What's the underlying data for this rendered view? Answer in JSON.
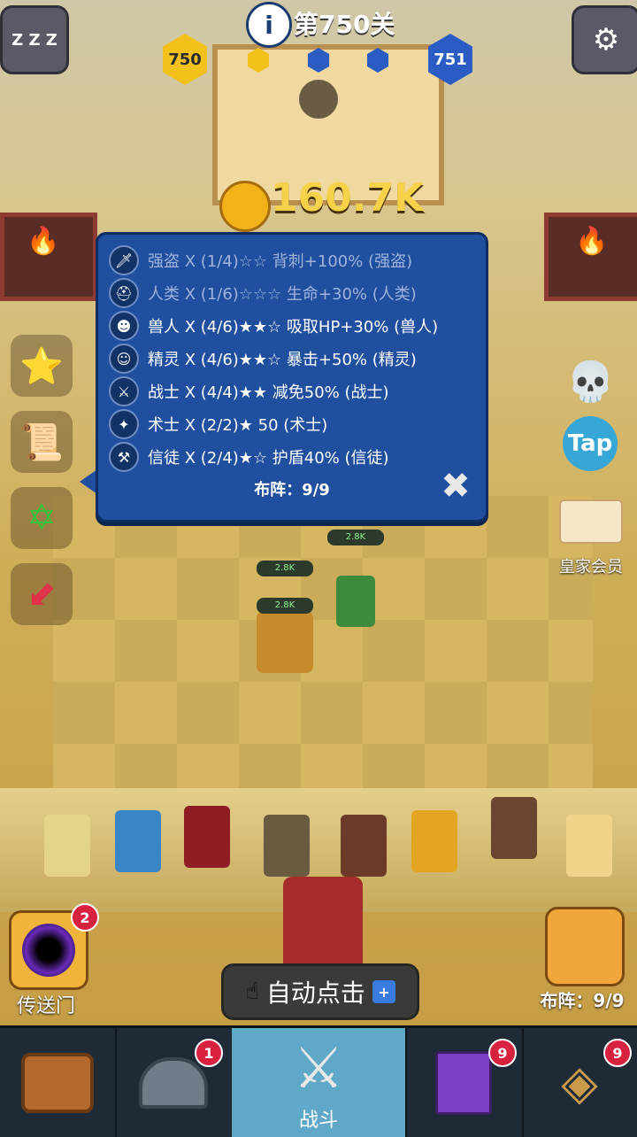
{
  "header": {
    "info_icon": "info-icon",
    "level_title": "第750关",
    "current_level": "750",
    "next_level": "751",
    "sleep_label": "Z Z Z",
    "gold": "160.7K"
  },
  "popup": {
    "rows": [
      {
        "icon": "sword-icon",
        "text": "强盗 X (1/4)☆☆ 背刺+100% (强盗)",
        "active": false
      },
      {
        "icon": "helmet-icon",
        "text": "人类 X (1/6)☆☆☆ 生命+30% (人类)",
        "active": false
      },
      {
        "icon": "orc-icon",
        "text": "兽人 X (4/6)★★☆ 吸取HP+30% (兽人)",
        "active": true
      },
      {
        "icon": "elf-icon",
        "text": "精灵 X (4/6)★★☆ 暴击+50% (精灵)",
        "active": true
      },
      {
        "icon": "warrior-sword-icon",
        "text": "战士 X (4/4)★★ 减免50% (战士)",
        "active": true
      },
      {
        "icon": "wizard-icon",
        "text": "术士 X (2/2)★ 50 (术士)",
        "active": true
      },
      {
        "icon": "hammer-icon",
        "text": "信徒 X (2/4)★☆ 护盾40% (信徒)",
        "active": true
      }
    ],
    "formation": "布阵：9/9"
  },
  "right_panel": {
    "tap_label": "Tap",
    "vip_label": "皇家会员",
    "formation_label": "布阵：9/9"
  },
  "units": {
    "hp_label": "2.8K"
  },
  "bottom": {
    "portal_label": "传送门",
    "portal_badge": "2",
    "auto_click_label": "自动点击",
    "tabs": [
      {
        "name": "tab-chest",
        "icon": "chest-icon",
        "label": "",
        "badge": ""
      },
      {
        "name": "tab-heroes",
        "icon": "viking-helmet-icon",
        "label": "",
        "badge": "1"
      },
      {
        "name": "tab-battle",
        "icon": "crossed-swords-icon",
        "label": "战斗",
        "badge": ""
      },
      {
        "name": "tab-book",
        "icon": "spellbook-icon",
        "label": "",
        "badge": "9"
      },
      {
        "name": "tab-amulet",
        "icon": "amulet-icon",
        "label": "",
        "badge": "9"
      }
    ]
  },
  "colors": {
    "popup_bg": "#1f4f9e",
    "hex_gold": "#f2c21a",
    "hex_blue": "#2a5cc4",
    "badge": "#d8213f",
    "active_tab": "#5fa8c8"
  }
}
